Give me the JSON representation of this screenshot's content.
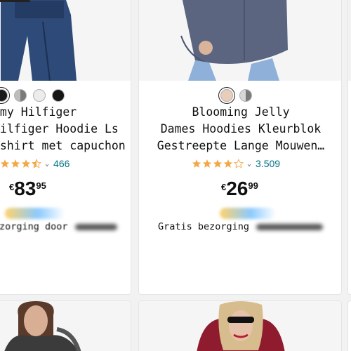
{
  "cards": [
    {
      "id": "left",
      "title_lines": [
        "mmy Hilfiger",
        "Hilfiger Hoodie Ls",
        "tshirt met capuchon"
      ],
      "swatch_colors": [
        "#1a1a1a",
        "#9a9a9a",
        "#e8e8e8",
        "#151515"
      ],
      "rating": 4.5,
      "review_count": "466",
      "price": {
        "currency": "€",
        "whole": "83",
        "fraction": "95"
      },
      "delivery_text": "zorging door"
    },
    {
      "id": "center",
      "title_lines": [
        "Blooming Jelly",
        "Dames Hoodies Kleurblok",
        "Gestreepte Lange Mouwen…"
      ],
      "swatch_colors": [
        "#e9cdb9",
        "#8e8e8e"
      ],
      "rating": 4,
      "review_count": "3.509",
      "price": {
        "currency": "€",
        "whole": "26",
        "fraction": "99"
      },
      "delivery_text": "Gratis bezorging"
    }
  ],
  "colors": {
    "star": "#f3a847",
    "link": "#007185",
    "card_border": "#e3e6e6",
    "page_bg": "#f2f2f2"
  },
  "icons": {
    "star": "star-icon",
    "chevron": "chevron-down-icon"
  }
}
